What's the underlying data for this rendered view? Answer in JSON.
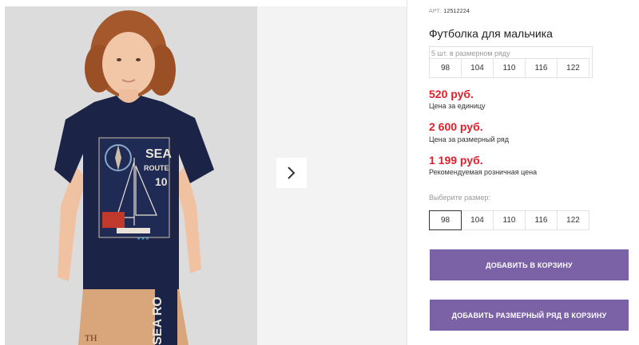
{
  "product": {
    "art_label": "АРТ.",
    "art_number": "12512224",
    "title": "Футболка для мальчика"
  },
  "size_series": {
    "caption": "5 шт. в размерном ряду",
    "sizes": [
      "98",
      "104",
      "110",
      "116",
      "122"
    ]
  },
  "prices": [
    {
      "value": "520 руб.",
      "note": "Цена за единицу"
    },
    {
      "value": "2 600 руб.",
      "note": "Цена за размерный ряд"
    },
    {
      "value": "1 199 руб.",
      "note": "Рекомендуемая розничная цена"
    }
  ],
  "size_picker": {
    "label": "Выберите размер:",
    "sizes": [
      "98",
      "104",
      "110",
      "116",
      "122"
    ],
    "selected": "98"
  },
  "buttons": {
    "add_to_cart": "ДОБАВИТЬ В КОРЗИНУ",
    "add_series_to_cart": "ДОБАВИТЬ РАЗМЕРНЫЙ РЯД В КОРЗИНУ"
  },
  "shirt_print": {
    "line1": "SEA",
    "line2": "ROUTE",
    "number": "10",
    "shorts_text": "SEA RO"
  },
  "colors": {
    "accent_button": "#7b62a6",
    "price_red": "#e3202a",
    "shirt_navy": "#1b2447",
    "shorts_tan": "#d9a57a"
  },
  "icons": {
    "next_arrow": "chevron-right-icon"
  }
}
